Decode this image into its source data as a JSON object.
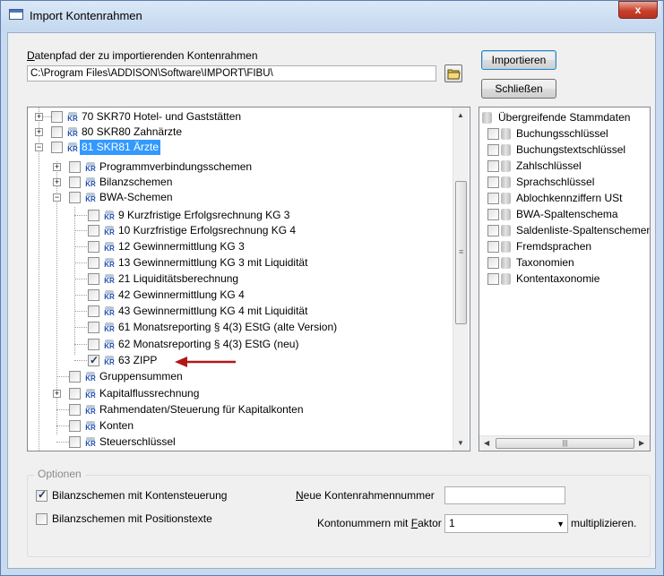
{
  "window": {
    "title": "Import Kontenrahmen",
    "close_label": "x"
  },
  "path": {
    "label_u": "D",
    "label_rest": "atenpfad der zu importierenden  Kontenrahmen",
    "value": "C:\\Program Files\\ADDISON\\Software\\IMPORT\\FIBU\\"
  },
  "buttons": {
    "import_label": "Importieren",
    "close_label": "Schließen"
  },
  "tree": {
    "items": [
      {
        "label": "70 SKR70 Hotel- und Gaststätten"
      },
      {
        "label": "80 SKR80 Zahnärzte"
      },
      {
        "label": "81 SKR81 Ärzte"
      },
      {
        "label": "Programmverbindungsschemen"
      },
      {
        "label": "Bilanzschemen"
      },
      {
        "label": "BWA-Schemen"
      },
      {
        "label": "9 Kurzfristige Erfolgsrechnung KG 3"
      },
      {
        "label": "10 Kurzfristige Erfolgsrechnung KG 4"
      },
      {
        "label": "12 Gewinnermittlung KG 3"
      },
      {
        "label": "13 Gewinnermittlung KG 3 mit Liquidität"
      },
      {
        "label": "21 Liquiditätsberechnung"
      },
      {
        "label": "42 Gewinnermittlung KG 4"
      },
      {
        "label": "43 Gewinnermittlung KG 4 mit Liquidität"
      },
      {
        "label": "61 Monatsreporting § 4(3) EStG (alte Version)"
      },
      {
        "label": "62 Monatsreporting § 4(3) EStG (neu)"
      },
      {
        "label": "63 ZIPP"
      },
      {
        "label": "Gruppensummen"
      },
      {
        "label": "Kapitalflussrechnung"
      },
      {
        "label": "Rahmendaten/Steuerung für Kapitalkonten"
      },
      {
        "label": "Konten"
      },
      {
        "label": "Steuerschlüssel"
      }
    ],
    "icon_text": "KR"
  },
  "stammdaten": {
    "header": "Übergreifende Stammdaten",
    "items": [
      "Buchungsschlüssel",
      "Buchungstextschlüssel",
      "Zahlschlüssel",
      "Sprachschlüssel",
      "Ablochkennziffern USt",
      "BWA-Spaltenschema",
      "Saldenliste-Spaltenschemen",
      "Fremdsprachen",
      "Taxonomien",
      "Kontentaxonomie"
    ]
  },
  "options": {
    "group_title": "Optionen",
    "cb1_label": "Bilanzschemen mit Kontensteuerung",
    "cb2_label": "Bilanzschemen mit Positionstexte",
    "new_number_u": "N",
    "new_number_rest": "eue Kontenrahmennummer",
    "new_number_value": "",
    "factor_pre": "Kontonummern mit ",
    "factor_u": "F",
    "factor_rest": "aktor",
    "factor_value": "1",
    "factor_post": "multiplizieren."
  }
}
